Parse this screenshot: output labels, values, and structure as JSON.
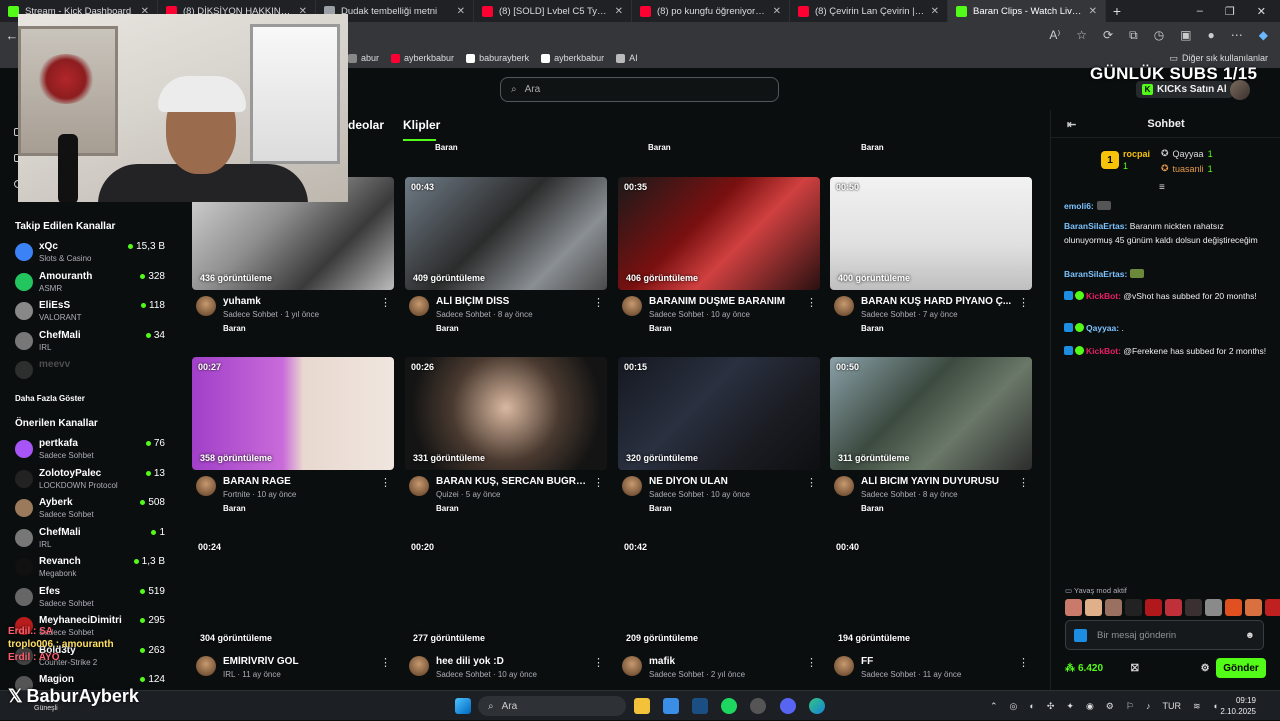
{
  "browser": {
    "tabs": [
      {
        "title": "Stream - Kick Dashboard",
        "color": "#53fc18"
      },
      {
        "title": "(8) DİKSİYON HAKKINDA HER ŞEY",
        "color": "#ff0033"
      },
      {
        "title": "Dudak tembelliği metni",
        "color": "#9aa0a6"
      },
      {
        "title": "(8) [SOLD] Lvbel C5 Type Club Be",
        "color": "#ff0033"
      },
      {
        "title": "(8) po kungfu öğreniyor kungfu y",
        "color": "#ff0033"
      },
      {
        "title": "(8) Çevirin Lan Çevirin | Recep İve",
        "color": "#ff0033"
      },
      {
        "title": "Baran Clips - Watch Live on Kick",
        "color": "#53fc18"
      }
    ],
    "bookmarks": [
      {
        "label": "abur",
        "color": "#888"
      },
      {
        "label": "ayberkbabur",
        "color": "#ff0033"
      },
      {
        "label": "baburayberk",
        "color": "#ffffff"
      },
      {
        "label": "ayberkbabur",
        "color": "#ffffff"
      },
      {
        "label": "AI",
        "color": "#bbbbbb"
      }
    ],
    "other_bookmarks": "Diğer sık kullanılanlar"
  },
  "kick": {
    "search_placeholder": "Ara",
    "overlay_title": "GÜNLÜK SUBS 1/15",
    "kicks_button": "KICKs Satın Al",
    "tabs": [
      "deolar",
      "Klipler"
    ]
  },
  "sidebar": {
    "followed_header": "Takip Edilen Kanallar",
    "followed": [
      {
        "name": "xQc",
        "category": "Slots & Casino",
        "viewers": "15,3 B",
        "color": "#3b82f6"
      },
      {
        "name": "Amouranth",
        "category": "ASMR",
        "viewers": "328",
        "color": "#22c55e"
      },
      {
        "name": "EliEsS",
        "category": "VALORANT",
        "viewers": "118",
        "color": "#888"
      },
      {
        "name": "ChefMali",
        "category": "IRL",
        "viewers": "34",
        "color": "#777"
      },
      {
        "name": "meevv",
        "category": "",
        "viewers": "",
        "color": "#444"
      }
    ],
    "show_more": "Daha Fazla Göster",
    "recommended_header": "Önerilen Kanallar",
    "recommended": [
      {
        "name": "pertkafa",
        "category": "Sadece Sohbet",
        "viewers": "76",
        "color": "#a855f7"
      },
      {
        "name": "ZolotoyPalec",
        "category": "LOCKDOWN Protocol",
        "viewers": "13",
        "color": "#222"
      },
      {
        "name": "Ayberk",
        "category": "Sadece Sohbet",
        "viewers": "508",
        "color": "#9a7a5a"
      },
      {
        "name": "ChefMali",
        "category": "IRL",
        "viewers": "1",
        "color": "#777"
      },
      {
        "name": "Revanch",
        "category": "Megabonk",
        "viewers": "1,3 B",
        "color": "#111"
      },
      {
        "name": "Efes",
        "category": "Sadece Sohbet",
        "viewers": "519",
        "color": "#666"
      },
      {
        "name": "MeyhaneciDimitri",
        "category": "Sadece Sohbet",
        "viewers": "295",
        "color": "#b91c1c"
      },
      {
        "name": "Bold3ty",
        "category": "Counter-Strike 2",
        "viewers": "263",
        "color": "#444"
      },
      {
        "name": "Magion",
        "category": "",
        "viewers": "124",
        "color": "#555"
      }
    ]
  },
  "clips": {
    "top_channel_labels": [
      "Baran",
      "Baran",
      "Baran"
    ],
    "items": [
      {
        "duration": "",
        "views": "436 görüntüleme",
        "title": "yuhamk",
        "category": "Sadece Sohbet",
        "age": "1 yıl önce",
        "channel": "Baran",
        "bg": "linear-gradient(135deg,#d9d9d9,#8f8f8f 40%,#3a3a3a 70%,#bdbdbd)"
      },
      {
        "duration": "00:43",
        "views": "409 görüntüleme",
        "title": "ALİ BİÇİM DİSS",
        "category": "Sadece Sohbet",
        "age": "8 ay önce",
        "channel": "Baran",
        "bg": "linear-gradient(135deg,#6e7b86,#2c2c2c 45%,#8a8f94 75%,#4a4a4a)"
      },
      {
        "duration": "00:35",
        "views": "406 görüntüleme",
        "title": "BARANIM DÜŞME BARANIM",
        "category": "Sadece Sohbet",
        "age": "10 ay önce",
        "channel": "Baran",
        "bg": "linear-gradient(135deg,#1a1a1a,#7a1010 40%,#d04040 60%,#2a1010)"
      },
      {
        "duration": "00:50",
        "views": "400 görüntüleme",
        "title": "BARAN KUŞ HARD PİYANO Ç...",
        "category": "Sadece Sohbet",
        "age": "7 ay önce",
        "channel": "Baran",
        "bg": "linear-gradient(180deg,#f2f2f2,#e0e0e0 60%,#bfbfbf)"
      },
      {
        "duration": "00:27",
        "views": "358 görüntüleme",
        "title": "BARAN RAGE",
        "category": "Fortnite",
        "age": "10 ay önce",
        "channel": "Baran",
        "bg": "linear-gradient(90deg,#a23fc9,#c96bd9 45%,#e8d8cf 55%,#f0e6df)"
      },
      {
        "duration": "00:26",
        "views": "331 görüntüleme",
        "title": "BARAN KUŞ, SERCAN BUĞRA ...",
        "category": "Quizei",
        "age": "5 ay önce",
        "channel": "Baran",
        "bg": "radial-gradient(circle at 50% 45%,#d9b8a0,#4a3a30 45%,#141414 80%)"
      },
      {
        "duration": "00:15",
        "views": "320 görüntüleme",
        "title": "NE DİYON ULAN",
        "category": "Sadece Sohbet",
        "age": "10 ay önce",
        "channel": "Baran",
        "bg": "linear-gradient(135deg,#151820,#2a3040 40%,#1a1c22 70%,#0e0f12)"
      },
      {
        "duration": "00:50",
        "views": "311 görüntüleme",
        "title": "ALİ BICIM YAYIN DUYURUSU",
        "category": "Sadece Sohbet",
        "age": "8 ay önce",
        "channel": "Baran",
        "bg": "linear-gradient(135deg,#8aa0a8,#3c4a40 40%,#6a7868 65%,#2c2c2c)"
      },
      {
        "duration": "00:24",
        "views": "304 görüntüleme",
        "title": "EMİRİVRİV GOL",
        "category": "IRL",
        "age": "11 ay önce",
        "channel": "",
        "bg": "#0b0e0f"
      },
      {
        "duration": "00:20",
        "views": "277 görüntüleme",
        "title": "hee dili yok :D",
        "category": "Sadece Sohbet",
        "age": "10 ay önce",
        "channel": "",
        "bg": "#0b0e0f"
      },
      {
        "duration": "00:42",
        "views": "209 görüntüleme",
        "title": "mafik",
        "category": "Sadece Sohbet",
        "age": "2 yıl önce",
        "channel": "",
        "bg": "#0b0e0f"
      },
      {
        "duration": "00:40",
        "views": "194 görüntüleme",
        "title": "FF",
        "category": "Sadece Sohbet",
        "age": "11 ay önce",
        "channel": "",
        "bg": "#0b0e0f"
      }
    ]
  },
  "chat": {
    "title": "Sohbet",
    "top_gifter": {
      "name": "rocpai",
      "count": "1"
    },
    "gifters": [
      {
        "name": "Qayyaa",
        "count": "1"
      },
      {
        "name": "tuasanli",
        "count": "1"
      }
    ],
    "messages": [
      {
        "user": "emoli6:",
        "text": "",
        "color": "#7cc3ff"
      },
      {
        "user": "BaranSilaErtas:",
        "text": "Baranım nickten rahatsız olunuyormuş 45 günüm kaldı dolsun değiştireceğim",
        "color": "#7cc3ff"
      },
      {
        "user": "BaranSilaErtas:",
        "text": "",
        "color": "#7cc3ff"
      },
      {
        "user": "KickBot:",
        "text": "@vShot has subbed for 20 months!",
        "color": "#e91e63"
      },
      {
        "user": "Qayyaa:",
        "text": ".",
        "color": "#7cc3ff"
      },
      {
        "user": "KickBot:",
        "text": "@Ferekene has subbed for 2 months!",
        "color": "#e91e63"
      }
    ],
    "slow_mode": "Yavaş mod aktif",
    "input_placeholder": "Bir mesaj gönderin",
    "points": "6.420",
    "send_label": "Gönder"
  },
  "stream_overlay": {
    "lines": [
      "Erdil.: SA",
      "troplo006 : amouranth",
      "Erdil : AYO"
    ],
    "brand": "BaburAyberk",
    "brand_sub": "Güneşli"
  },
  "taskbar": {
    "search_label": "Ara",
    "lang": "TUR",
    "time": "09:19",
    "date": "2.10.2025"
  }
}
